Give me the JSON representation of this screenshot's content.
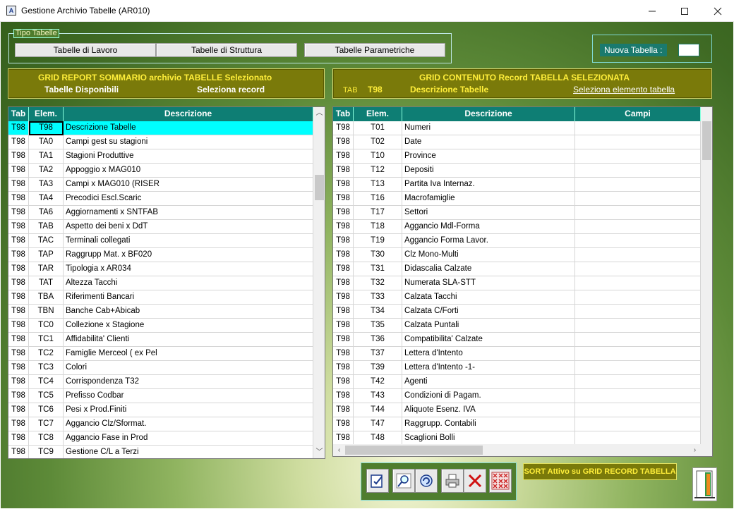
{
  "window": {
    "title": "Gestione Archivio Tabelle (AR010)",
    "icon_letter": "A"
  },
  "tipo": {
    "legend": "Tipo Tabelle",
    "buttons": [
      "Tabelle di Lavoro",
      "Tabelle di Struttura",
      "Tabelle Parametriche"
    ]
  },
  "nuova": {
    "label": "Nuova Tabella :",
    "value": ""
  },
  "left_panel": {
    "title": "GRID REPORT SOMMARIO archivio TABELLE  Selezionato",
    "sub_left": "Tabelle Disponibili",
    "sub_right": "Seleziona record"
  },
  "right_panel": {
    "title": "GRID CONTENUTO Record TABELLA SELEZIONATA",
    "tab_label": "TAB",
    "tab_value": "T98",
    "desc": "Descrizione Tabelle",
    "link": "Seleziona elemento tabella"
  },
  "left_grid": {
    "headers": [
      "Tab",
      "Elem.",
      "Descrizione"
    ],
    "rows": [
      [
        "T98",
        "T98",
        "Descrizione Tabelle"
      ],
      [
        "T98",
        "TA0",
        "Campi gest su stagioni"
      ],
      [
        "T98",
        "TA1",
        "Stagioni Produttive"
      ],
      [
        "T98",
        "TA2",
        "Appoggio x MAG010"
      ],
      [
        "T98",
        "TA3",
        "Campi x MAG010 (RISER"
      ],
      [
        "T98",
        "TA4",
        "Precodici Escl.Scaric"
      ],
      [
        "T98",
        "TA6",
        "Aggiornamenti x SNTFAB"
      ],
      [
        "T98",
        "TAB",
        "Aspetto dei beni x DdT"
      ],
      [
        "T98",
        "TAC",
        "Terminali collegati"
      ],
      [
        "T98",
        "TAP",
        "Raggrupp Mat. x BF020"
      ],
      [
        "T98",
        "TAR",
        "Tipologia x AR034"
      ],
      [
        "T98",
        "TAT",
        "Altezza Tacchi"
      ],
      [
        "T98",
        "TBA",
        "Riferimenti Bancari"
      ],
      [
        "T98",
        "TBN",
        "Banche Cab+Abicab"
      ],
      [
        "T98",
        "TC0",
        "Collezione x Stagione"
      ],
      [
        "T98",
        "TC1",
        "Affidabilita' Clienti"
      ],
      [
        "T98",
        "TC2",
        "Famiglie Merceol ( ex Pel"
      ],
      [
        "T98",
        "TC3",
        "Colori"
      ],
      [
        "T98",
        "TC4",
        "Corrispondenza T32"
      ],
      [
        "T98",
        "TC5",
        "Prefisso Codbar"
      ],
      [
        "T98",
        "TC6",
        "Pesi x Prod.Finiti"
      ],
      [
        "T98",
        "TC7",
        "Aggancio Clz/Sformat."
      ],
      [
        "T98",
        "TC8",
        "Aggancio Fase in Prod"
      ],
      [
        "T98",
        "TC9",
        "Gestione C/L a Terzi"
      ]
    ]
  },
  "right_grid": {
    "headers": [
      "Tab",
      "Elem.",
      "Descrizione",
      "Campi"
    ],
    "rows": [
      [
        "T98",
        "T01",
        "Numeri",
        ""
      ],
      [
        "T98",
        "T02",
        "Date",
        ""
      ],
      [
        "T98",
        "T10",
        "Province",
        ""
      ],
      [
        "T98",
        "T12",
        "Depositi",
        ""
      ],
      [
        "T98",
        "T13",
        "Partita Iva Internaz.",
        ""
      ],
      [
        "T98",
        "T16",
        "Macrofamiglie",
        ""
      ],
      [
        "T98",
        "T17",
        "Settori",
        ""
      ],
      [
        "T98",
        "T18",
        "Aggancio Mdl-Forma",
        ""
      ],
      [
        "T98",
        "T19",
        "Aggancio Forma Lavor.",
        ""
      ],
      [
        "T98",
        "T30",
        "Clz Mono-Multi",
        ""
      ],
      [
        "T98",
        "T31",
        "Didascalia Calzate",
        ""
      ],
      [
        "T98",
        "T32",
        "Numerata SLA-STT",
        ""
      ],
      [
        "T98",
        "T33",
        "Calzata Tacchi",
        ""
      ],
      [
        "T98",
        "T34",
        "Calzata C/Forti",
        ""
      ],
      [
        "T98",
        "T35",
        "Calzata Puntali",
        ""
      ],
      [
        "T98",
        "T36",
        "Compatibilita' Calzate",
        ""
      ],
      [
        "T98",
        "T37",
        "Lettera d'Intento",
        ""
      ],
      [
        "T98",
        "T39",
        "Lettera d'Intento -1-",
        ""
      ],
      [
        "T98",
        "T42",
        "Agenti",
        ""
      ],
      [
        "T98",
        "T43",
        "Condizioni di Pagam.",
        ""
      ],
      [
        "T98",
        "T44",
        "Aliquote Esenz. IVA",
        ""
      ],
      [
        "T98",
        "T47",
        "Raggrupp. Contabili",
        ""
      ],
      [
        "T98",
        "T48",
        "Scaglioni Bolli",
        ""
      ]
    ]
  },
  "sort_label": "SORT Attivo su GRID RECORD TABELLA",
  "toolbar_icons": [
    "edit-check-icon",
    "zoom-icon",
    "refresh-icon",
    "print-icon",
    "delete-icon",
    "grid-clear-icon"
  ],
  "colors": {
    "header": "#0e7e74",
    "selection": "#00ffff",
    "olive": "#7a7a0a",
    "title_yellow": "#ffee3a"
  }
}
